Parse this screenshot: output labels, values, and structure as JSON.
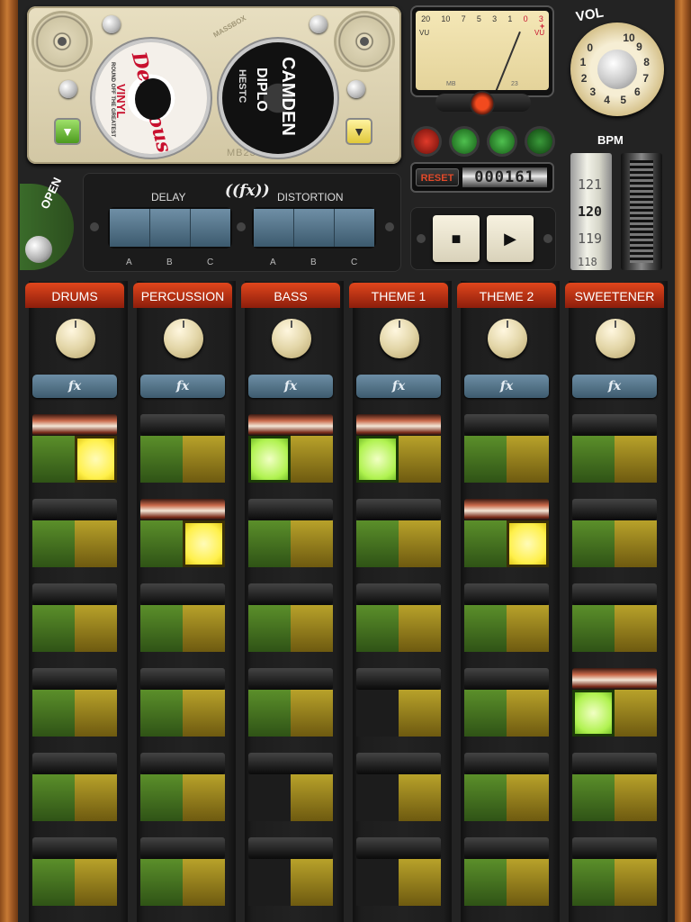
{
  "deck": {
    "record_a": {
      "line1": "Delicious",
      "line2": "VINYL",
      "line3": "ROUND OFF THE GREATEST"
    },
    "record_b": {
      "line1": "DIPLO",
      "line2": "CAMDEN",
      "line3": "HESTC"
    },
    "label": "MB23",
    "brand": "MASSBOX"
  },
  "vu": {
    "scale": [
      "20",
      "10",
      "7",
      "5",
      "3",
      "1",
      "0",
      "3"
    ],
    "left_label": "VU",
    "right_label": "VU",
    "plus": "+",
    "model_left": "MB",
    "model_right": "23"
  },
  "counter": {
    "reset_label": "RESET",
    "value": "000161"
  },
  "vol": {
    "label": "VOL",
    "numbers": [
      "10",
      "9",
      "8",
      "7",
      "6",
      "5",
      "4",
      "3",
      "2",
      "1",
      "0"
    ]
  },
  "bpm": {
    "label": "BPM",
    "values": [
      "121",
      "120",
      "119",
      "118"
    ],
    "current": 120
  },
  "fx_panel": {
    "open_label": "OPEN",
    "fx_symbol": "((fx))",
    "delay_label": "DELAY",
    "distortion_label": "DISTORTION",
    "slots": [
      "A",
      "B",
      "C"
    ]
  },
  "channels": [
    {
      "name": "DRUMS",
      "fx": "fx"
    },
    {
      "name": "PERCUSSION",
      "fx": "fx"
    },
    {
      "name": "BASS",
      "fx": "fx"
    },
    {
      "name": "THEME 1",
      "fx": "fx"
    },
    {
      "name": "THEME 2",
      "fx": "fx"
    },
    {
      "name": "SWEETENER",
      "fx": "fx"
    }
  ],
  "lamp_colors": [
    "#b11a14",
    "#2c8a2c",
    "#2c8a2c",
    "#1f6a1f"
  ],
  "accent_red": "#e0461c"
}
